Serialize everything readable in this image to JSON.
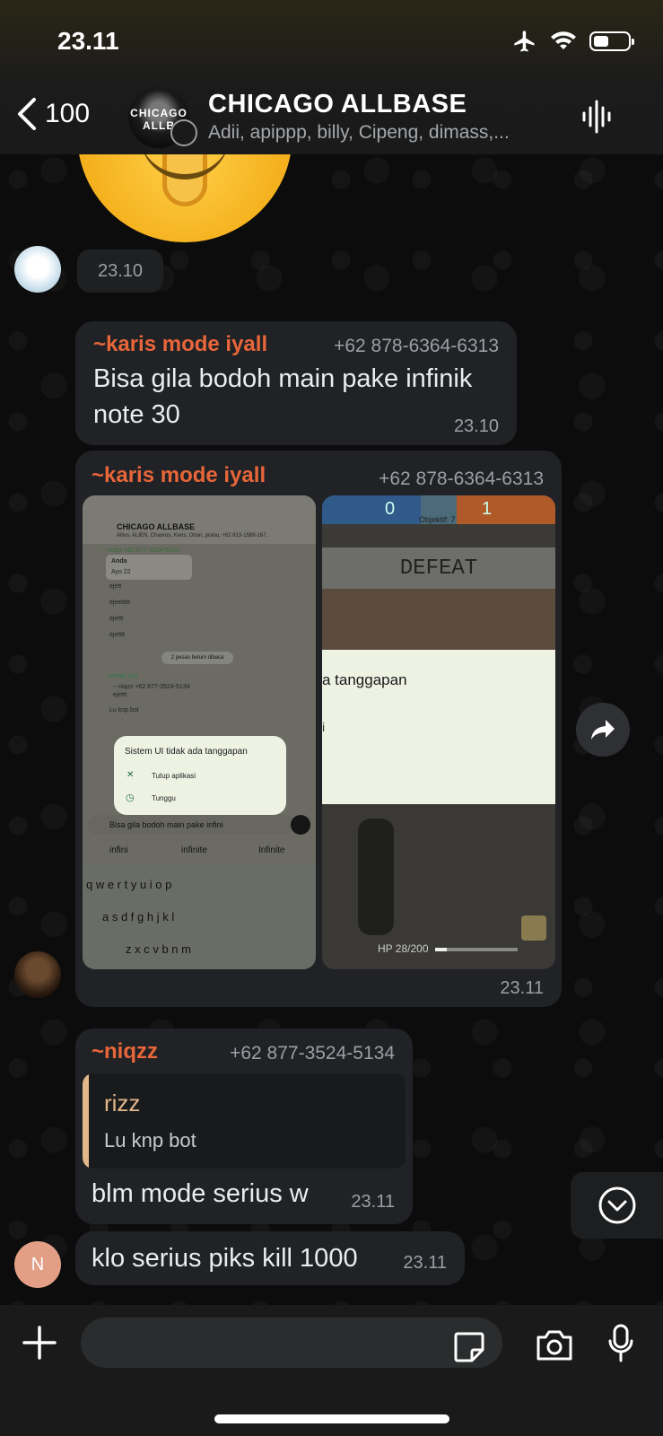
{
  "status_bar": {
    "time": "23.11",
    "battery_level": 0.45
  },
  "header": {
    "back_count": "100",
    "group_avatar_text": "CHICAGO ALLB",
    "title": "CHICAGO ALLBASE",
    "members": "Adii, apippp, billy, Cipeng, dimass,..."
  },
  "messages": {
    "time_pill": "23.10",
    "m1": {
      "sender": "~karis mode iyall",
      "phone": "+62 878-6364-6313",
      "text": "Bisa gila bodoh main pake infinik note 30",
      "time": "23.10"
    },
    "m2": {
      "sender": "~karis mode iyall",
      "phone": "+62 878-6364-6313",
      "time": "23.11",
      "shot1": {
        "title": "CHICAGO ALLBASE",
        "subtitle": "Allivs, ALIEN, Chaoros, Keris, Orion, prabu, +62 813-1589-167..",
        "lines": [
          "~ niqzz  +62 877-3524-5134",
          "Anda",
          "Ayo 22",
          "ejett",
          "ejeettttt",
          "ejettt",
          "ejetttt"
        ],
        "unread": "2 pesan belum dibaca",
        "reply_name": "mesin rizz",
        "reply_quote": "~ niqzz  +62 877-3524-5134",
        "reply_quote_text": "ejettt",
        "reply_text": "Lu knp bot",
        "dialog_title": "Sistem UI tidak ada tanggapan",
        "dialog_opt1": "Tutup aplikasi",
        "dialog_opt2": "Tunggu",
        "input_text": "Bisa gila bodoh main pake infini",
        "suggestions": [
          "infini",
          "infinite",
          "Infinite"
        ],
        "keys_row1": "q w e r t y u i o p",
        "keys_row2": "a s d f g h j k l",
        "keys_row3": "z x c v b n m"
      },
      "shot2": {
        "score_left": "0",
        "score_right": "1",
        "objective": "Objektif: 7",
        "defeat": "DEFEAT",
        "overlay_text": "a tanggapan",
        "overlay_i": "i",
        "hp": "HP 28/200",
        "hp_fraction": 0.14
      }
    },
    "m3": {
      "sender": "~niqzz",
      "phone": "+62 877-3524-5134",
      "quote_name": "rizz",
      "quote_text": "Lu knp bot",
      "text": "blm mode serius w",
      "time": "23.11"
    },
    "m4": {
      "avatar_letter": "N",
      "text": "klo serius piks kill 1000",
      "time": "23.11"
    }
  },
  "colors": {
    "sender_orange": "#e8663a",
    "quote_accent": "#e2b78a",
    "bubble": "#202225"
  },
  "icons": [
    "back-chevron-icon",
    "airplane-icon",
    "wifi-icon",
    "battery-icon",
    "voice-call-icon",
    "forward-icon",
    "chevron-down-icon",
    "plus-icon",
    "sticker-icon",
    "camera-icon",
    "microphone-icon"
  ]
}
